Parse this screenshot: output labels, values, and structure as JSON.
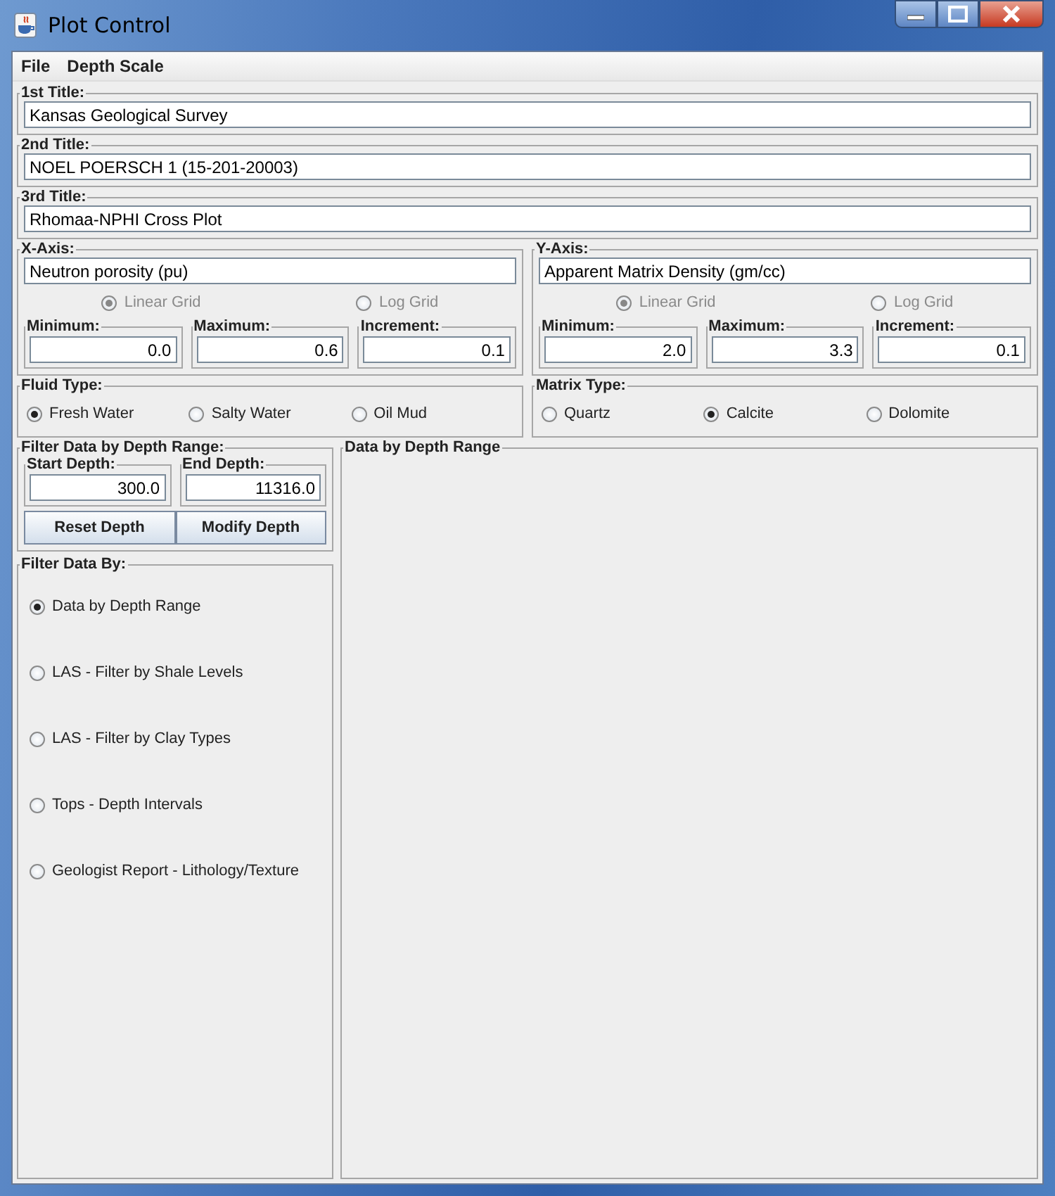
{
  "window": {
    "title": "Plot Control"
  },
  "menu": [
    "File",
    "Depth Scale"
  ],
  "titles": [
    {
      "label": "1st Title:",
      "value": "Kansas Geological Survey"
    },
    {
      "label": "2nd Title:",
      "value": "NOEL POERSCH 1 (15-201-20003)"
    },
    {
      "label": "3rd Title:",
      "value": "Rhomaa-NPHI Cross Plot"
    }
  ],
  "axes": [
    {
      "label": "X-Axis:",
      "value": "Neutron porosity (pu)",
      "grid_options": [
        {
          "label": "Linear Grid",
          "selected": true,
          "disabled": true
        },
        {
          "label": "Log Grid",
          "selected": false,
          "disabled": true
        }
      ],
      "fields": [
        {
          "label": "Minimum:",
          "value": "0.0"
        },
        {
          "label": "Maximum:",
          "value": "0.6"
        },
        {
          "label": "Increment:",
          "value": "0.1"
        }
      ]
    },
    {
      "label": "Y-Axis:",
      "value": "Apparent Matrix Density (gm/cc)",
      "grid_options": [
        {
          "label": "Linear Grid",
          "selected": true,
          "disabled": true
        },
        {
          "label": "Log Grid",
          "selected": false,
          "disabled": true
        }
      ],
      "fields": [
        {
          "label": "Minimum:",
          "value": "2.0"
        },
        {
          "label": "Maximum:",
          "value": "3.3"
        },
        {
          "label": "Increment:",
          "value": "0.1"
        }
      ]
    }
  ],
  "types": [
    {
      "label": "Fluid Type:",
      "options": [
        {
          "label": "Fresh Water",
          "selected": true,
          "disabled": false
        },
        {
          "label": "Salty Water",
          "selected": false,
          "disabled": false
        },
        {
          "label": "Oil Mud",
          "selected": false,
          "disabled": false
        }
      ]
    },
    {
      "label": "Matrix Type:",
      "options": [
        {
          "label": "Quartz",
          "selected": false,
          "disabled": false
        },
        {
          "label": "Calcite",
          "selected": true,
          "disabled": false
        },
        {
          "label": "Dolomite",
          "selected": false,
          "disabled": false
        }
      ]
    }
  ],
  "depth_filter": {
    "label": "Filter Data by Depth Range:",
    "fields": [
      {
        "label": "Start Depth:",
        "value": "300.0"
      },
      {
        "label": "End Depth:",
        "value": "11316.0"
      }
    ],
    "buttons": [
      "Reset Depth",
      "Modify Depth"
    ]
  },
  "filter_by": {
    "label": "Filter Data By:",
    "options": [
      {
        "label": "Data by Depth Range",
        "selected": true,
        "disabled": false
      },
      {
        "label": "LAS - Filter by Shale Levels",
        "selected": false,
        "disabled": false
      },
      {
        "label": "LAS - Filter by Clay Types",
        "selected": false,
        "disabled": false
      },
      {
        "label": "Tops - Depth Intervals",
        "selected": false,
        "disabled": false
      },
      {
        "label": "Geologist Report - Lithology/Texture",
        "selected": false,
        "disabled": false
      }
    ]
  },
  "panel": {
    "label": "Data by Depth Range"
  }
}
